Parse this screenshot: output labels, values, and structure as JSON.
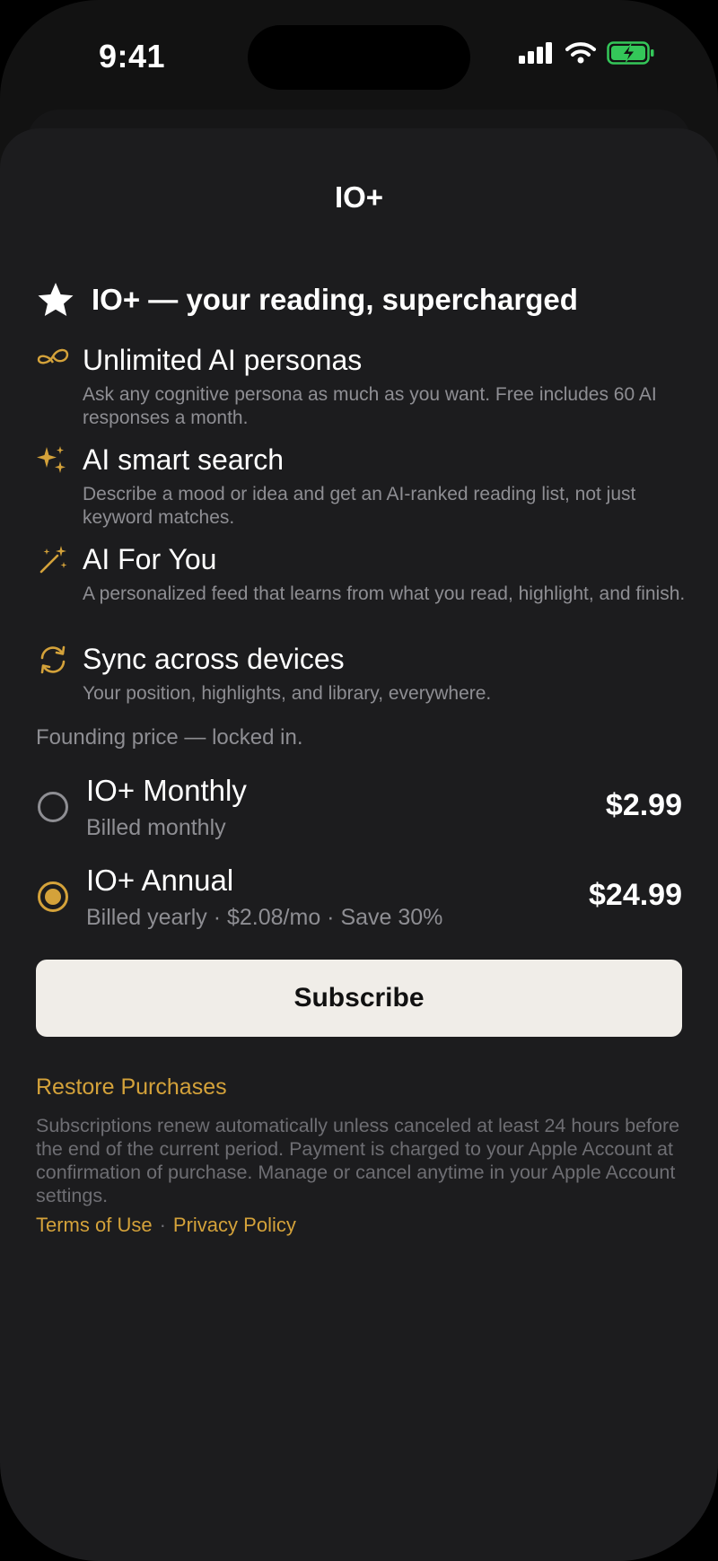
{
  "status_bar": {
    "time": "9:41"
  },
  "sheet": {
    "title": "IO+"
  },
  "hero": {
    "icon": "star-icon",
    "title": "IO+ — your reading, supercharged"
  },
  "features": [
    {
      "icon": "infinity-icon",
      "title": "Unlimited AI personas",
      "description": "Ask any cognitive persona as much as you want. Free includes 60 AI responses a month."
    },
    {
      "icon": "sparkles-icon",
      "title": "AI smart search",
      "description": "Describe a mood or idea and get an AI-ranked reading list, not just keyword matches."
    },
    {
      "icon": "magic-wand-icon",
      "title": "AI For You",
      "description": "A personalized feed that learns from what you read, highlight, and finish."
    },
    {
      "icon": "sync-icon",
      "title": "Sync across devices",
      "description": "Your position, highlights, and library, everywhere."
    }
  ],
  "founding_note": "Founding price — locked in.",
  "plans": [
    {
      "name": "IO+ Monthly",
      "subtitle": "Billed monthly",
      "price": "$2.99",
      "selected": false
    },
    {
      "name": "IO+ Annual",
      "subtitle": "Billed yearly · $2.08/mo · Save 30%",
      "price": "$24.99",
      "selected": true
    }
  ],
  "subscribe_label": "Subscribe",
  "restore_label": "Restore Purchases",
  "legal_text": "Subscriptions renew automatically unless canceled at least 24 hours before the end of the current period. Payment is charged to your Apple Account at confirmation of purchase. Manage or cancel anytime in your Apple Account settings.",
  "links": {
    "terms": "Terms of Use",
    "separator": "·",
    "privacy": "Privacy Policy"
  },
  "colors": {
    "accent": "#d4a23a",
    "sheet_background": "#1c1c1e",
    "button_background": "#f0ede8",
    "battery": "#34c759"
  }
}
